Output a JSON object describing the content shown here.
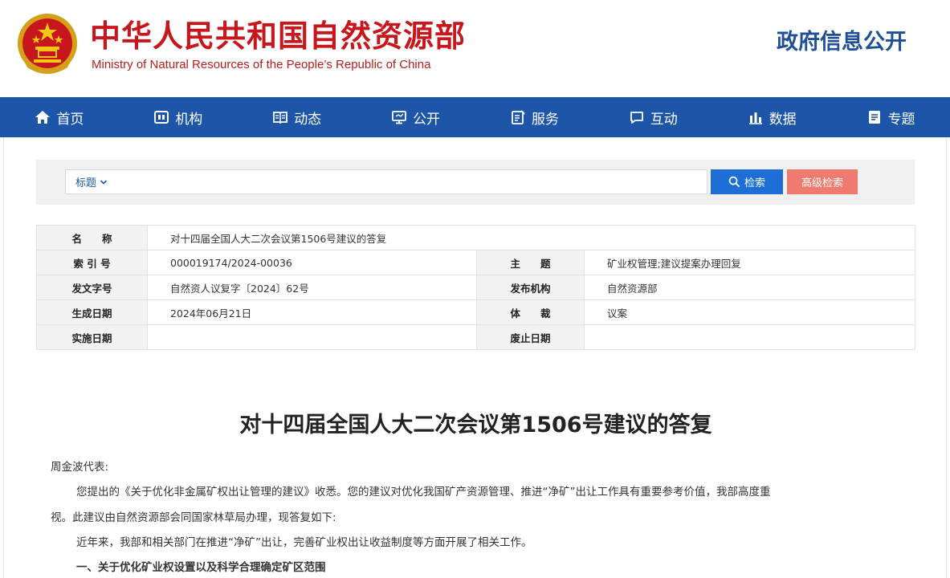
{
  "header": {
    "title_cn": "中华人民共和国自然资源部",
    "title_en": "Ministry of Natural Resources of the People’s Republic of China",
    "section": "政府信息公开",
    "brand_color": "#c8161d",
    "section_color": "#1f4f96"
  },
  "nav": {
    "color": "#1d56a8",
    "items": [
      {
        "label": "首页",
        "icon": "home-icon"
      },
      {
        "label": "机构",
        "icon": "organization-icon"
      },
      {
        "label": "动态",
        "icon": "news-icon"
      },
      {
        "label": "公开",
        "icon": "monitor-icon"
      },
      {
        "label": "服务",
        "icon": "service-icon"
      },
      {
        "label": "互动",
        "icon": "chat-icon"
      },
      {
        "label": "数据",
        "icon": "bar-chart-icon"
      },
      {
        "label": "专题",
        "icon": "topic-icon"
      }
    ]
  },
  "search": {
    "type_label": "标题",
    "value": "",
    "button": "检索",
    "advanced": "高级检索"
  },
  "meta": {
    "name_key": "名　　称",
    "name_val": "对十四届全国人大二次会议第1506号建议的答复",
    "index_key": "索 引 号",
    "index_val": "000019174/2024-00036",
    "subject_key": "主　　题",
    "subject_val": "矿业权管理;建议提案办理回复",
    "docno_key": "发文字号",
    "docno_val": "自然资人议复字〔2024〕62号",
    "org_key": "发布机构",
    "org_val": "自然资源部",
    "date_key": "生成日期",
    "date_val": "2024年06月21日",
    "genre_key": "体　　裁",
    "genre_val": "议案",
    "effective_key": "实施日期",
    "effective_val": "",
    "expire_key": "废止日期",
    "expire_val": ""
  },
  "article": {
    "title": "对十四届全国人大二次会议第1506号建议的答复",
    "salutation": "周金波代表:",
    "p1_line1": "您提出的《关于优化非金属矿权出让管理的建议》收悉。您的建议对优化我国矿产资源管理、推进“净矿”出让工作具有重要参考价值，我部高度重",
    "p1_line2": "视。此建议由自然资源部会同国家林草局办理，现答复如下:",
    "p2": "近年来，我部和相关部门在推进“净矿”出让，完善矿业权出让收益制度等方面开展了相关工作。",
    "h1": "一、关于优化矿业权设置以及科学合理确定矿区范围"
  }
}
